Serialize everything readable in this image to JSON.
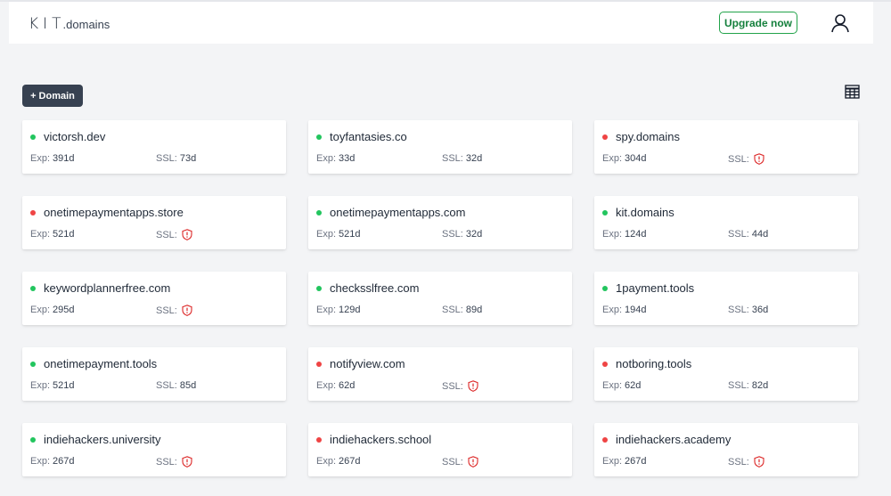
{
  "header": {
    "logo_mark": "KIT",
    "logo_suffix": ".domains",
    "upgrade_label": "Upgrade now"
  },
  "toolbar": {
    "add_domain_label": "+ Domain"
  },
  "icons": {
    "user": "user-icon",
    "table_view": "table-icon",
    "ssl_warning": "shield-alert-icon"
  },
  "colors": {
    "active": "#22c55e",
    "inactive": "#ef4444",
    "button_dark": "#374151",
    "upgrade_green": "#15803d"
  },
  "labels": {
    "exp": "Exp:",
    "ssl": "SSL:"
  },
  "domains": [
    {
      "name": "victorsh.dev",
      "status": "active",
      "exp": "391d",
      "ssl": "73d"
    },
    {
      "name": "toyfantasies.co",
      "status": "active",
      "exp": "33d",
      "ssl": "32d"
    },
    {
      "name": "spy.domains",
      "status": "inactive",
      "exp": "304d",
      "ssl": null
    },
    {
      "name": "onetimepaymentapps.store",
      "status": "inactive",
      "exp": "521d",
      "ssl": null
    },
    {
      "name": "onetimepaymentapps.com",
      "status": "active",
      "exp": "521d",
      "ssl": "32d"
    },
    {
      "name": "kit.domains",
      "status": "active",
      "exp": "124d",
      "ssl": "44d"
    },
    {
      "name": "keywordplannerfree.com",
      "status": "active",
      "exp": "295d",
      "ssl": null
    },
    {
      "name": "checksslfree.com",
      "status": "active",
      "exp": "129d",
      "ssl": "89d"
    },
    {
      "name": "1payment.tools",
      "status": "active",
      "exp": "194d",
      "ssl": "36d"
    },
    {
      "name": "onetimepayment.tools",
      "status": "active",
      "exp": "521d",
      "ssl": "85d"
    },
    {
      "name": "notifyview.com",
      "status": "inactive",
      "exp": "62d",
      "ssl": null
    },
    {
      "name": "notboring.tools",
      "status": "inactive",
      "exp": "62d",
      "ssl": "82d"
    },
    {
      "name": "indiehackers.university",
      "status": "active",
      "exp": "267d",
      "ssl": null
    },
    {
      "name": "indiehackers.school",
      "status": "inactive",
      "exp": "267d",
      "ssl": null
    },
    {
      "name": "indiehackers.academy",
      "status": "inactive",
      "exp": "267d",
      "ssl": null
    }
  ]
}
